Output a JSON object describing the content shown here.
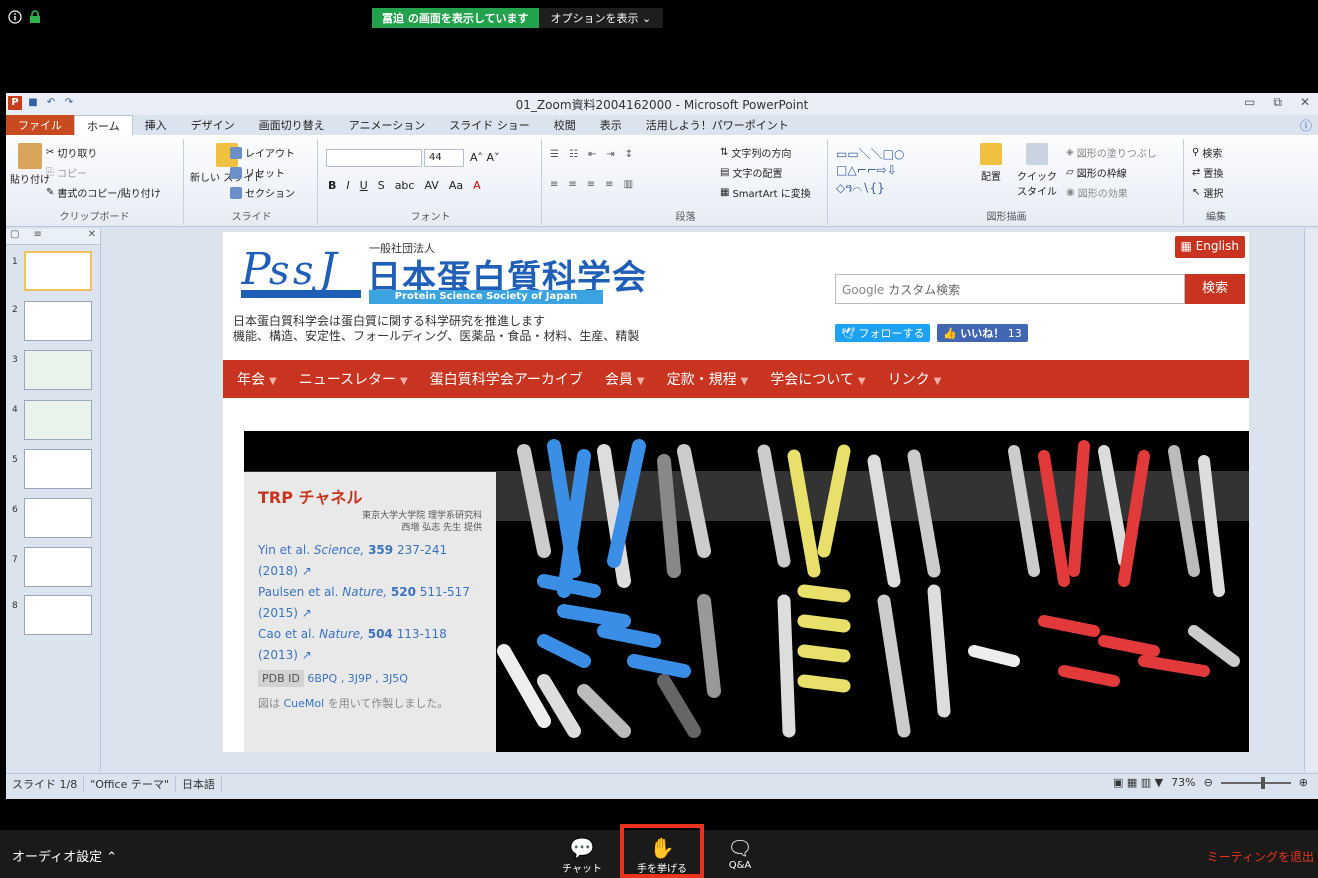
{
  "share": {
    "sharing_text": "冨迫 の画面を表示しています",
    "options_label": "オプションを表示"
  },
  "ppt": {
    "window_title": "01_Zoom資料2004162000 - Microsoft PowerPoint",
    "tabs": [
      "ファイル",
      "ホーム",
      "挿入",
      "デザイン",
      "画面切り替え",
      "アニメーション",
      "スライド ショー",
      "校閲",
      "表示",
      "活用しよう！パワーポイント"
    ],
    "ribbon": {
      "clipboard": {
        "paste": "貼り付け",
        "cut": "切り取り",
        "copy": "コピー",
        "format_copy": "書式のコピー/貼り付け",
        "label": "クリップボード"
      },
      "slides": {
        "new_slide": "新しい スライド",
        "layout": "レイアウト",
        "reset": "リセット",
        "section": "セクション",
        "label": "スライド"
      },
      "font": {
        "size": "44",
        "label": "フォント"
      },
      "paragraph": {
        "text_dir": "文字列の方向",
        "align_text": "文字の配置",
        "smartart": "SmartArt に変換",
        "label": "段落"
      },
      "drawing": {
        "arrange": "配置",
        "quick_style": "クイック スタイル",
        "fill": "図形の塗りつぶし",
        "outline": "図形の枠線",
        "effects": "図形の効果",
        "label": "図形描画"
      },
      "editing": {
        "find": "検索",
        "replace": "置換",
        "select": "選択",
        "label": "編集"
      }
    },
    "status": {
      "slide": "スライド 1/8",
      "theme": "\"Office テーマ\"",
      "lang": "日本語",
      "zoom": "73%"
    },
    "thumb_numbers": [
      "1",
      "2",
      "3",
      "4",
      "5",
      "6",
      "7",
      "8"
    ]
  },
  "slide": {
    "org_sub": "一般社団法人",
    "org_name": "日本蛋白質科学会",
    "org_en": "Protein Science Society of Japan",
    "tagline1": "日本蛋白質科学会は蛋白質に関する科学研究を推進します",
    "tagline2": "機能、構造、安定性、フォールディング、医薬品・食品・材料、生産、精製",
    "english": "English",
    "search_placeholder": "カスタム検索",
    "search_btn": "検索",
    "follow": "フォローする",
    "like": "いいね！",
    "like_count": "13",
    "nav": [
      "年会",
      "ニュースレター",
      "蛋白質科学会アーカイブ",
      "会員",
      "定款・規程",
      "学会について",
      "リンク"
    ],
    "banner": {
      "title": "TRP チャネル",
      "affil1": "東京大学大学院 理学系研究科",
      "affil2": "西増 弘志 先生 提供",
      "refs": [
        {
          "authors": "Yin et al.",
          "journal": "Science,",
          "vol": "359",
          "pages": "237-241",
          "year": "(2018)"
        },
        {
          "authors": "Paulsen et al.",
          "journal": "Nature,",
          "vol": "520",
          "pages": "511-517",
          "year": "(2015)"
        },
        {
          "authors": "Cao et al.",
          "journal": "Nature,",
          "vol": "504",
          "pages": "113-118",
          "year": "(2013)"
        }
      ],
      "pdb_label": "PDB ID",
      "pdb_ids": "6BPQ , 3J9P , 3J5Q",
      "cuemol_pre": "図は",
      "cuemol": "CueMol",
      "cuemol_post": "を用いて作製しました。"
    }
  },
  "zoombar": {
    "audio": "オーディオ設定",
    "chat": "チャット",
    "raise": "手を挙げる",
    "qa": "Q&A",
    "leave": "ミーティングを退出"
  },
  "colors": {
    "accent_red": "#c8341f",
    "blue": "#3a8ee6",
    "yellow": "#e8e06a",
    "red": "#e23a3a"
  }
}
